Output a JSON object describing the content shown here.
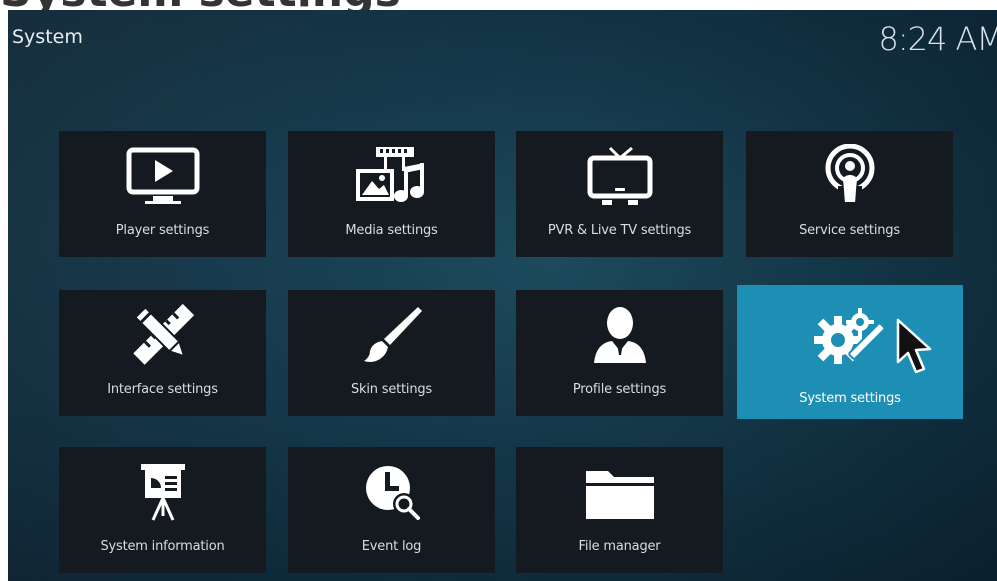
{
  "page": {
    "cropped_heading": "System settings",
    "title": "System",
    "clock": "8:24 AM"
  },
  "tiles": [
    {
      "label": "Player settings",
      "icon": "player-icon"
    },
    {
      "label": "Media settings",
      "icon": "media-icon"
    },
    {
      "label": "PVR & Live TV settings",
      "icon": "tv-icon"
    },
    {
      "label": "Service settings",
      "icon": "podcast-icon"
    },
    {
      "label": "Interface settings",
      "icon": "pencil-ruler-icon"
    },
    {
      "label": "Skin settings",
      "icon": "paintbrush-icon"
    },
    {
      "label": "Profile settings",
      "icon": "profile-icon"
    },
    {
      "label": "System settings",
      "icon": "gears-tools-icon",
      "focused": true
    },
    {
      "label": "System information",
      "icon": "presentation-icon"
    },
    {
      "label": "Event log",
      "icon": "clock-search-icon"
    },
    {
      "label": "File manager",
      "icon": "folder-icon"
    }
  ],
  "colors": {
    "background": "#14384a",
    "tile": "#141a1f",
    "focused_tile": "#1d8fb4",
    "text": "#d7dde1"
  }
}
